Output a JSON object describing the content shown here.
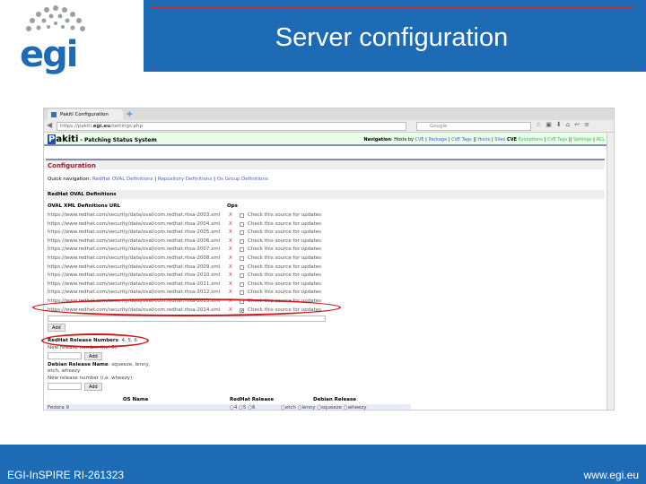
{
  "slide": {
    "title": "Server configuration",
    "footer_left": "EGI-InSPIRE RI-261323",
    "footer_right": "www.egi.eu",
    "logo_text": "egi"
  },
  "browser": {
    "tab_title": "Pakiti Configuration",
    "url_prefix": "https://pakiti.",
    "url_domain": "egi.eu",
    "url_path": "/settings.php",
    "search_placeholder": "Google"
  },
  "app": {
    "logo_initial": "P",
    "logo_rest": "akiti",
    "subtitle": " - Patching Status System",
    "nav": {
      "label": "Navigation",
      "hosts_by": "Hosts by",
      "items": [
        "CVE",
        "Package",
        "CVE Tags",
        "Hosts",
        "Sites"
      ],
      "cve_label": "CVE",
      "cve_items": [
        "Exceptions",
        "CVE Tags",
        "Settings",
        "ACL"
      ]
    },
    "page_heading": "Configuration",
    "quick_nav": {
      "label": "Quick navigation:",
      "links": [
        "RedHat OVAL Definitions",
        "Repository Definitions",
        "Os Group Definitions"
      ]
    },
    "oval_section": "RedHat OVAL Definitions",
    "oval_col_url": "OVAL XML Definitions URL",
    "oval_col_ops": "Ops",
    "oval_rows": [
      {
        "url": "https://www.redhat.com/security/data/oval/com.redhat.rhsa-2003.xml",
        "checked": false
      },
      {
        "url": "https://www.redhat.com/security/data/oval/com.redhat.rhsa-2004.xml",
        "checked": false
      },
      {
        "url": "https://www.redhat.com/security/data/oval/com.redhat.rhsa-2005.xml",
        "checked": false
      },
      {
        "url": "https://www.redhat.com/security/data/oval/com.redhat.rhsa-2006.xml",
        "checked": false
      },
      {
        "url": "https://www.redhat.com/security/data/oval/com.redhat.rhsa-2007.xml",
        "checked": false
      },
      {
        "url": "https://www.redhat.com/security/data/oval/com.redhat.rhsa-2008.xml",
        "checked": false
      },
      {
        "url": "https://www.redhat.com/security/data/oval/com.redhat.rhsa-2009.xml",
        "checked": false
      },
      {
        "url": "https://www.redhat.com/security/data/oval/com.redhat.rhsa-2010.xml",
        "checked": false
      },
      {
        "url": "https://www.redhat.com/security/data/oval/com.redhat.rhsa-2011.xml",
        "checked": false
      },
      {
        "url": "https://www.redhat.com/security/data/oval/com.redhat.rhsa-2012.xml",
        "checked": false
      },
      {
        "url": "https://www.redhat.com/security/data/oval/com.redhat.rhsa-2013.xml",
        "checked": false
      },
      {
        "url": "https://www.redhat.com/security/data/oval/com.redhat.rhsa-2014.xml",
        "checked": true
      }
    ],
    "delete_label": "X",
    "check_label": "Check this source for updates",
    "add_label": "Add",
    "rh_release_label": "RedHat Release Numbers",
    "rh_release_values": ": 4, 5, 6",
    "rh_new_label": "New release number (i.e. 6):",
    "deb_release_label": "Debian Release Name",
    "deb_release_values": ": squeeze, lenny,",
    "deb_release_values2": "etch, wheezy",
    "deb_new_label": "New release number (i.e. wheezy):",
    "os_table": {
      "headers": [
        "OS Name",
        "RedHat Release",
        "Debian Release"
      ],
      "row": {
        "name": "Fedora 9",
        "rh_options": [
          "4",
          "5",
          "6"
        ],
        "deb_options": [
          "etch",
          "lenny",
          "squeeze",
          "wheezy"
        ]
      }
    }
  }
}
